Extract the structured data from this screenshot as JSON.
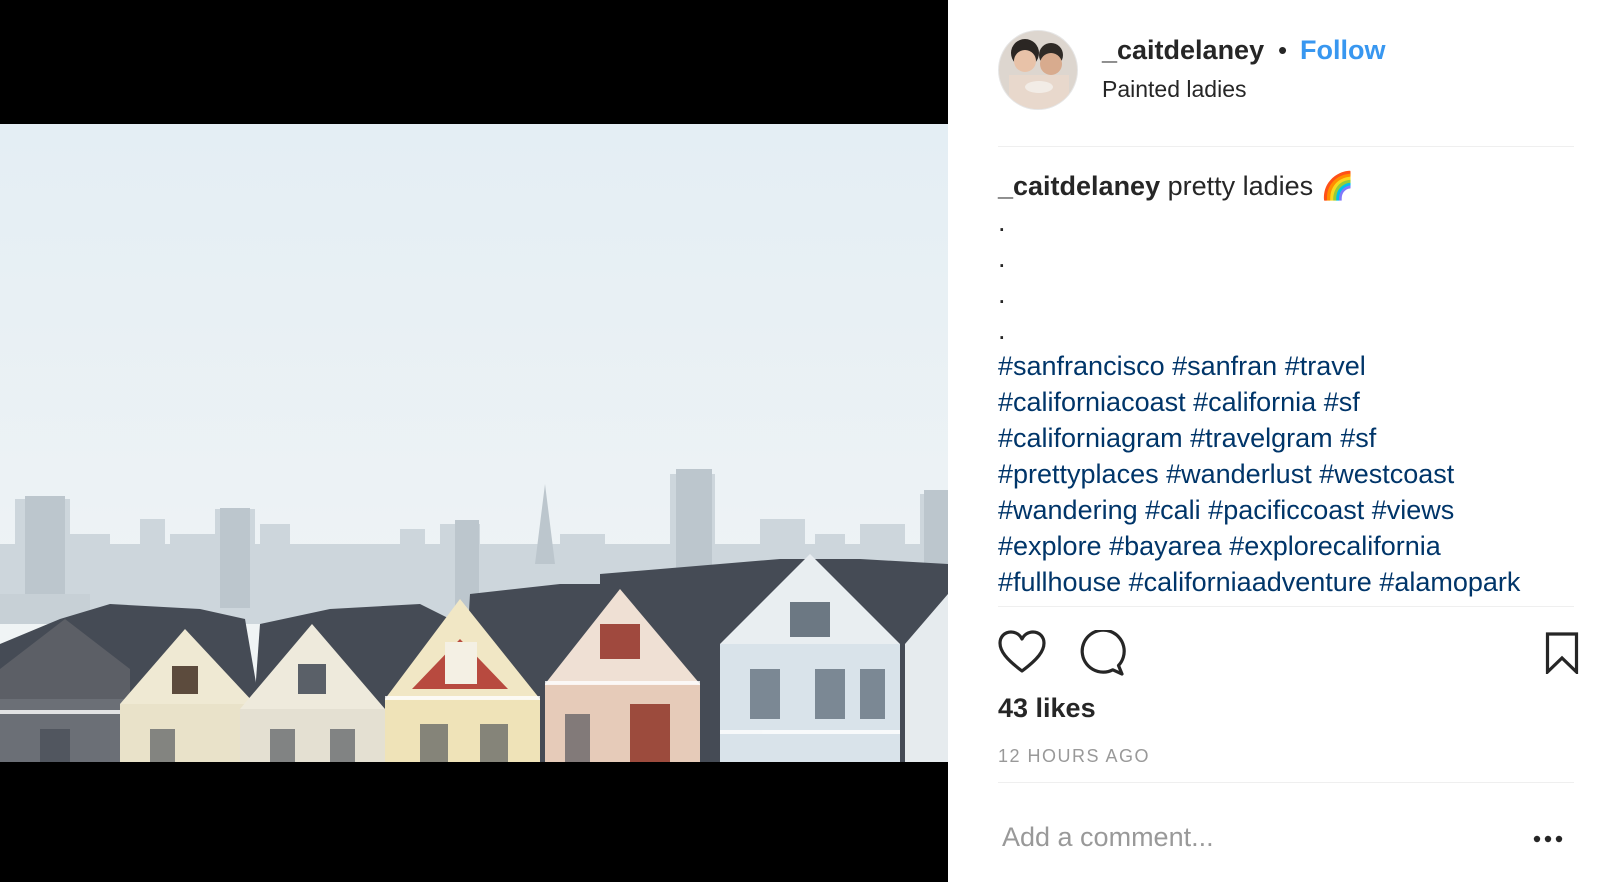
{
  "post": {
    "username": "_caitdelaney",
    "separator": "•",
    "follow_label": "Follow",
    "location": "Painted ladies",
    "caption_text": "pretty ladies 🌈",
    "dots": [
      ".",
      ".",
      ".",
      "."
    ],
    "hashtag_lines": [
      [
        "#sanfrancisco",
        "#sanfran",
        "#travel"
      ],
      [
        "#californiacoast",
        "#california",
        "#sf"
      ],
      [
        "#californiagram",
        "#travelgram",
        "#sf"
      ],
      [
        "#prettyplaces",
        "#wanderlust",
        "#westcoast"
      ],
      [
        "#wandering",
        "#cali",
        "#pacificcoast",
        "#views"
      ],
      [
        "#explore",
        "#bayarea",
        "#explorecalifornia"
      ],
      [
        "#fullhouse",
        "#californiaadventure",
        "#alamopark"
      ]
    ],
    "likes": "43 likes",
    "timestamp": "12 HOURS AGO"
  },
  "comment": {
    "placeholder": "Add a comment..."
  },
  "icons": {
    "like": "heart-icon",
    "comment": "comment-bubble-icon",
    "save": "bookmark-icon",
    "more": "more-options-icon"
  },
  "colors": {
    "follow": "#3897f0",
    "hashtag": "#003569",
    "text": "#262626",
    "muted": "#999999",
    "media_background": "#000000"
  }
}
